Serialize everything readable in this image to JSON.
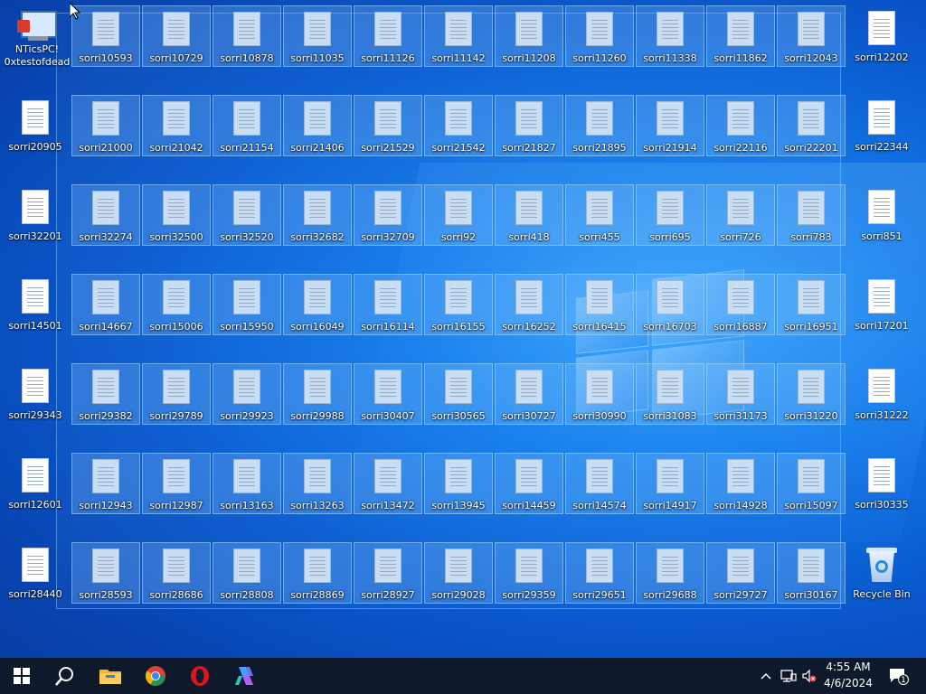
{
  "desktop": {
    "nt_icon": {
      "line1": "NTicsPC!",
      "line2": "0xtestofdead"
    },
    "rows": [
      [
        "sorri10593",
        "sorri10729",
        "sorri10878",
        "sorri11035",
        "sorri11126",
        "sorri11142",
        "sorri11208",
        "sorri11260",
        "sorri11338",
        "sorri11862",
        "sorri12043",
        "sorri12202"
      ],
      [
        "sorri20905",
        "sorri21000",
        "sorri21042",
        "sorri21154",
        "sorri21406",
        "sorri21529",
        "sorri21542",
        "sorri21827",
        "sorri21895",
        "sorri21914",
        "sorri22116",
        "sorri22201",
        "sorri22344"
      ],
      [
        "sorri32201",
        "sorri32274",
        "sorri32500",
        "sorri32520",
        "sorri32682",
        "sorri32709",
        "sorri92",
        "sorri418",
        "sorri455",
        "sorri695",
        "sorri726",
        "sorri783",
        "sorri851"
      ],
      [
        "sorri14501",
        "sorri14667",
        "sorri15006",
        "sorri15950",
        "sorri16049",
        "sorri16114",
        "sorri16155",
        "sorri16252",
        "sorri16415",
        "sorri16703",
        "sorri16887",
        "sorri16951",
        "sorri17201"
      ],
      [
        "sorri29343",
        "sorri29382",
        "sorri29789",
        "sorri29923",
        "sorri29988",
        "sorri30407",
        "sorri30565",
        "sorri30727",
        "sorri30990",
        "sorri31083",
        "sorri31173",
        "sorri31220",
        "sorri31222"
      ],
      [
        "sorri12601",
        "sorri12943",
        "sorri12987",
        "sorri13163",
        "sorri13263",
        "sorri13472",
        "sorri13945",
        "sorri14459",
        "sorri14574",
        "sorri14917",
        "sorri14928",
        "sorri15097",
        "sorri30335"
      ],
      [
        "sorri28440",
        "sorri28593",
        "sorri28686",
        "sorri28808",
        "sorri28869",
        "sorri28927",
        "sorri29028",
        "sorri29359",
        "sorri29651",
        "sorri29688",
        "sorri29727",
        "sorri30167"
      ]
    ],
    "recycle_bin_label": "Recycle Bin"
  },
  "taskbar": {
    "icons": [
      "windows-start-icon",
      "search-icon",
      "file-explorer-icon",
      "chrome-icon",
      "opera-icon",
      "copilot-icon"
    ],
    "time": "4:55 AM",
    "date": "4/6/2024",
    "notification_count": "1"
  }
}
